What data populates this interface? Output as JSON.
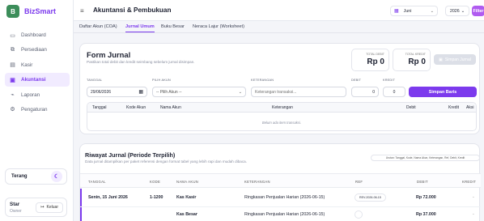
{
  "app": {
    "name": "BizSmart",
    "logo_glyph": "B"
  },
  "sidebar": {
    "items": [
      {
        "label": "Dashboard",
        "icon": "▭",
        "active": false
      },
      {
        "label": "Persediaan",
        "icon": "⧉",
        "active": false
      },
      {
        "label": "Kasir",
        "icon": "▤",
        "active": false
      },
      {
        "label": "Akuntansi",
        "icon": "▣",
        "active": true
      },
      {
        "label": "Laporan",
        "icon": "⌁",
        "active": false
      },
      {
        "label": "Pengaturan",
        "icon": "⚙",
        "active": false
      }
    ],
    "theme_label": "Terang",
    "theme_icon": "☾",
    "user_name": "Star",
    "user_role": "Owner",
    "logout_label": "Keluar",
    "logout_icon": "↦"
  },
  "header": {
    "menu_icon": "≡",
    "title": "Akuntansi & Pembukuan",
    "period_icon": "▦",
    "period_value": "Juni",
    "year_value": "2026",
    "chevron": "⌄",
    "filter_label": "Filter"
  },
  "tabs": [
    "Daftar Akun (COA)",
    "Jurnal Umum",
    "Buku Besar",
    "Neraca Lajur (Worksheet)"
  ],
  "active_tab": "Jurnal Umum",
  "form": {
    "title": "Form Jurnal",
    "subtitle": "Pastikan total debit dan kredit seimbang sebelum jurnal disimpan.",
    "total_debit_label": "TOTAL DEBIT",
    "total_debit_value": "Rp 0",
    "total_kredit_label": "TOTAL KREDIT",
    "total_kredit_value": "Rp 0",
    "save_journal_label": "Simpan Jurnal",
    "tanggal_label": "TANGGAL",
    "tanggal_value": "29/06/2026",
    "akun_label": "PILIH AKUN",
    "akun_value": "-- Pilih Akun --",
    "keterangan_label": "KETERANGAN",
    "keterangan_placeholder": "Keterangan transaksi...",
    "debit_label": "DEBIT",
    "debit_value": "0",
    "kredit_label": "KREDIT",
    "kredit_value": "0",
    "save_row_label": "Simpan Baris",
    "table_columns": [
      "Tanggal",
      "Kode Akun",
      "Nama Akun",
      "Keterangan",
      "Debit",
      "Kredit",
      "Aksi"
    ],
    "empty_text": "Belum ada item transaksi."
  },
  "riwayat": {
    "title": "Riwayat Jurnal (Periode Terpilih)",
    "subtitle": "Data jurnal ditampilkan per paket referensi dengan format tabel yang lebih rapi dan mudah dibaca.",
    "order_chip": "Urutan: Tanggal, Kode, Nama Akun, Keterangan, Ref, Debit, Kredit",
    "columns": [
      "TANGGAL",
      "KODE",
      "NAMA AKUN",
      "KETERANGAN",
      "REF",
      "DEBIT",
      "KREDIT"
    ],
    "rows": [
      {
        "tanggal": "Senin, 15 Juni 2026",
        "kode": "1-1200",
        "nama": "Kas Kasir",
        "keterangan": "Ringkasan Penjualan Harian (2026-06-15)",
        "ref": "REV-2026-06-15",
        "debit": "Rp 72.000",
        "kredit": "-"
      },
      {
        "tanggal": "",
        "kode": "",
        "nama": "Kas Besar",
        "keterangan": "Ringkasan Penjualan Harian (2026-06-15)",
        "ref": "",
        "debit": "Rp 37.000",
        "kredit": "-"
      }
    ]
  },
  "colors": {
    "accent": "#7c3aed",
    "filter": "#b05bf0",
    "brand_logo": "#3c8d5a"
  }
}
